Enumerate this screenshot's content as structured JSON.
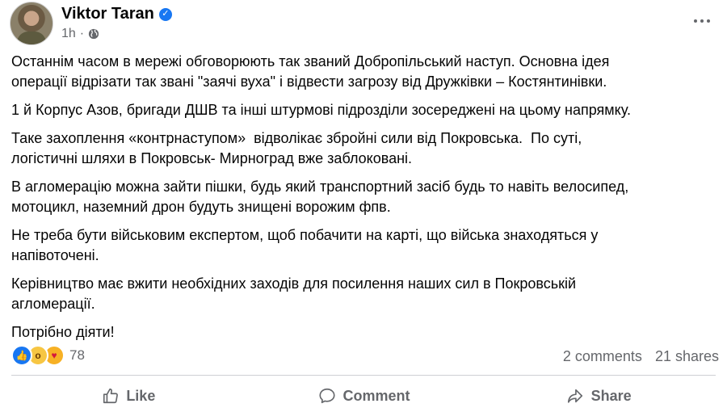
{
  "post": {
    "author": "Viktor Taran",
    "time": "1h",
    "paragraphs": [
      "Останнім часом в мережі обговорюють так званий Добропільський наступ. Основна ідея\nоперації відрізати так звані \"заячі вуха\" і відвести загрозу від Дружківки – Костянтинівки.",
      "1 й Корпус Азов, бригади ДШВ та інші штурмові підрозділи зосереджені на цьому напрямку.",
      "Таке захоплення «контрнаступом»  відволікає збройні сили від Покровська.  По суті,\nлогістичні шляхи в Покровськ- Мирноград вже заблоковані.",
      "В агломерацію можна зайти пішки, будь який транспортний засіб будь то навіть велосипед,\nмотоцикл, наземний дрон будуть знищені ворожим фпв.",
      "Не треба бути військовим експертом, щоб побачити на карті, що війська знаходяться у\nнапівоточені.",
      "Керівництво має вжити необхідних заходів для посилення наших сил в Покровській\nагломерації.",
      "Потрібно діяти!"
    ]
  },
  "reactions": {
    "icons": [
      "like-icon",
      "wow-icon",
      "care-icon"
    ],
    "count": "78"
  },
  "stats": {
    "comments": "2 comments",
    "shares": "21 shares"
  },
  "actions": {
    "like": "Like",
    "comment": "Comment",
    "share": "Share"
  },
  "colors": {
    "verified": "#1877f2",
    "secondary_text": "#65676b"
  }
}
